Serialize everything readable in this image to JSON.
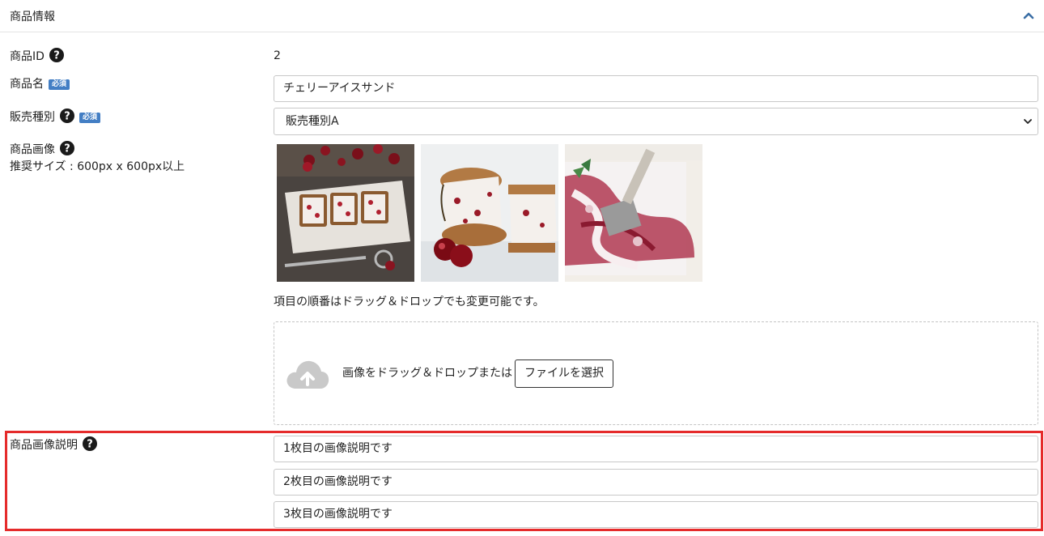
{
  "header": {
    "title": "商品情報"
  },
  "product_id": {
    "label": "商品ID",
    "value": "2"
  },
  "product_name": {
    "label": "商品名",
    "required_badge": "必須",
    "value": "チェリーアイスサンド"
  },
  "sales_type": {
    "label": "販売種別",
    "required_badge": "必須",
    "selected": "販売種別A"
  },
  "product_image": {
    "label": "商品画像",
    "recommended_size": "推奨サイズ : 600px x 600px以上",
    "images": [
      "cherry-ice-sandwiches-tray",
      "ice-cream-sandwich-with-cherries",
      "cherry-ice-cream-with-scoop"
    ],
    "reorder_help": "項目の順番はドラッグ＆ドロップでも変更可能です。",
    "dropzone_text": "画像をドラッグ＆ドロップまたは",
    "file_button": "ファイルを選択"
  },
  "image_descriptions": {
    "label": "商品画像説明",
    "values": [
      "1枚目の画像説明です",
      "2枚目の画像説明です",
      "3枚目の画像説明です"
    ]
  },
  "colors": {
    "badge": "#437ec4",
    "highlight": "#e52b2b",
    "accent": "#3b6ea5"
  },
  "icons": [
    "chevron-up-icon",
    "question-circle-icon",
    "chevron-down-icon",
    "cloud-upload-icon"
  ]
}
